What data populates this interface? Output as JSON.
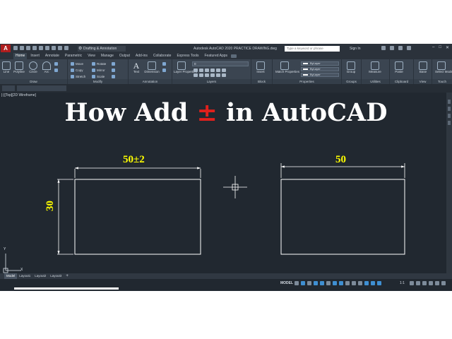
{
  "titlebar": {
    "logo": "A",
    "workspace": "Drafting & Annotation",
    "title": "Autodesk AutoCAD 2020   PRACTICE DRAWING.dwg",
    "search_placeholder": "Type a keyword or phrase",
    "signin": "Sign In"
  },
  "tabs": [
    "Home",
    "Insert",
    "Annotate",
    "Parametric",
    "View",
    "Manage",
    "Output",
    "Add-ins",
    "Collaborate",
    "Express Tools",
    "Featured Apps"
  ],
  "ribbon": {
    "draw": {
      "title": "Draw",
      "line": "Line",
      "polyline": "Polyline",
      "circle": "Circle",
      "arc": "Arc"
    },
    "modify": {
      "title": "Modify",
      "move": "Move",
      "rotate": "Rotate",
      "copy": "Copy",
      "mirror": "Mirror",
      "stretch": "Stretch",
      "scale": "Scale"
    },
    "annotation": {
      "title": "Annotation",
      "text": "Text",
      "dimension": "Dimension"
    },
    "layers": {
      "title": "Layers",
      "properties": "Layer Properties",
      "current": "0"
    },
    "block": {
      "title": "Block",
      "insert": "Insert"
    },
    "properties": {
      "title": "Properties",
      "match": "Match Properties",
      "color": "ByLayer",
      "linetype": "ByLayer",
      "lineweight": "ByLayer"
    },
    "groups": {
      "title": "Groups",
      "group": "Group"
    },
    "utilities": {
      "title": "Utilities",
      "measure": "Measure"
    },
    "clipboard": {
      "title": "Clipboard",
      "paste": "Paste"
    },
    "view": {
      "title": "View",
      "base": "Base"
    },
    "touch": {
      "title": "Touch",
      "select_mode": "Select Mode"
    }
  },
  "viewport": {
    "label": "[-][Top][2D Wireframe]"
  },
  "headline": {
    "part1": "How Add ",
    "symbol": "±",
    "part2": " in AutoCAD"
  },
  "drawing": {
    "left_width_dim": "50±2",
    "left_height_dim": "30",
    "right_width_dim": "50"
  },
  "ucs": {
    "x_label": "X",
    "y_label": "Y"
  },
  "layout_tabs": [
    "Model",
    "Layout1",
    "Layout2",
    "Layout3",
    "+"
  ],
  "status": {
    "model": "MODEL",
    "scale": "1:1"
  },
  "colors": {
    "canvas": "#212830",
    "dimension_text": "#ffff00",
    "plus_minus": "#e0201c",
    "geometry": "#ffffff"
  }
}
